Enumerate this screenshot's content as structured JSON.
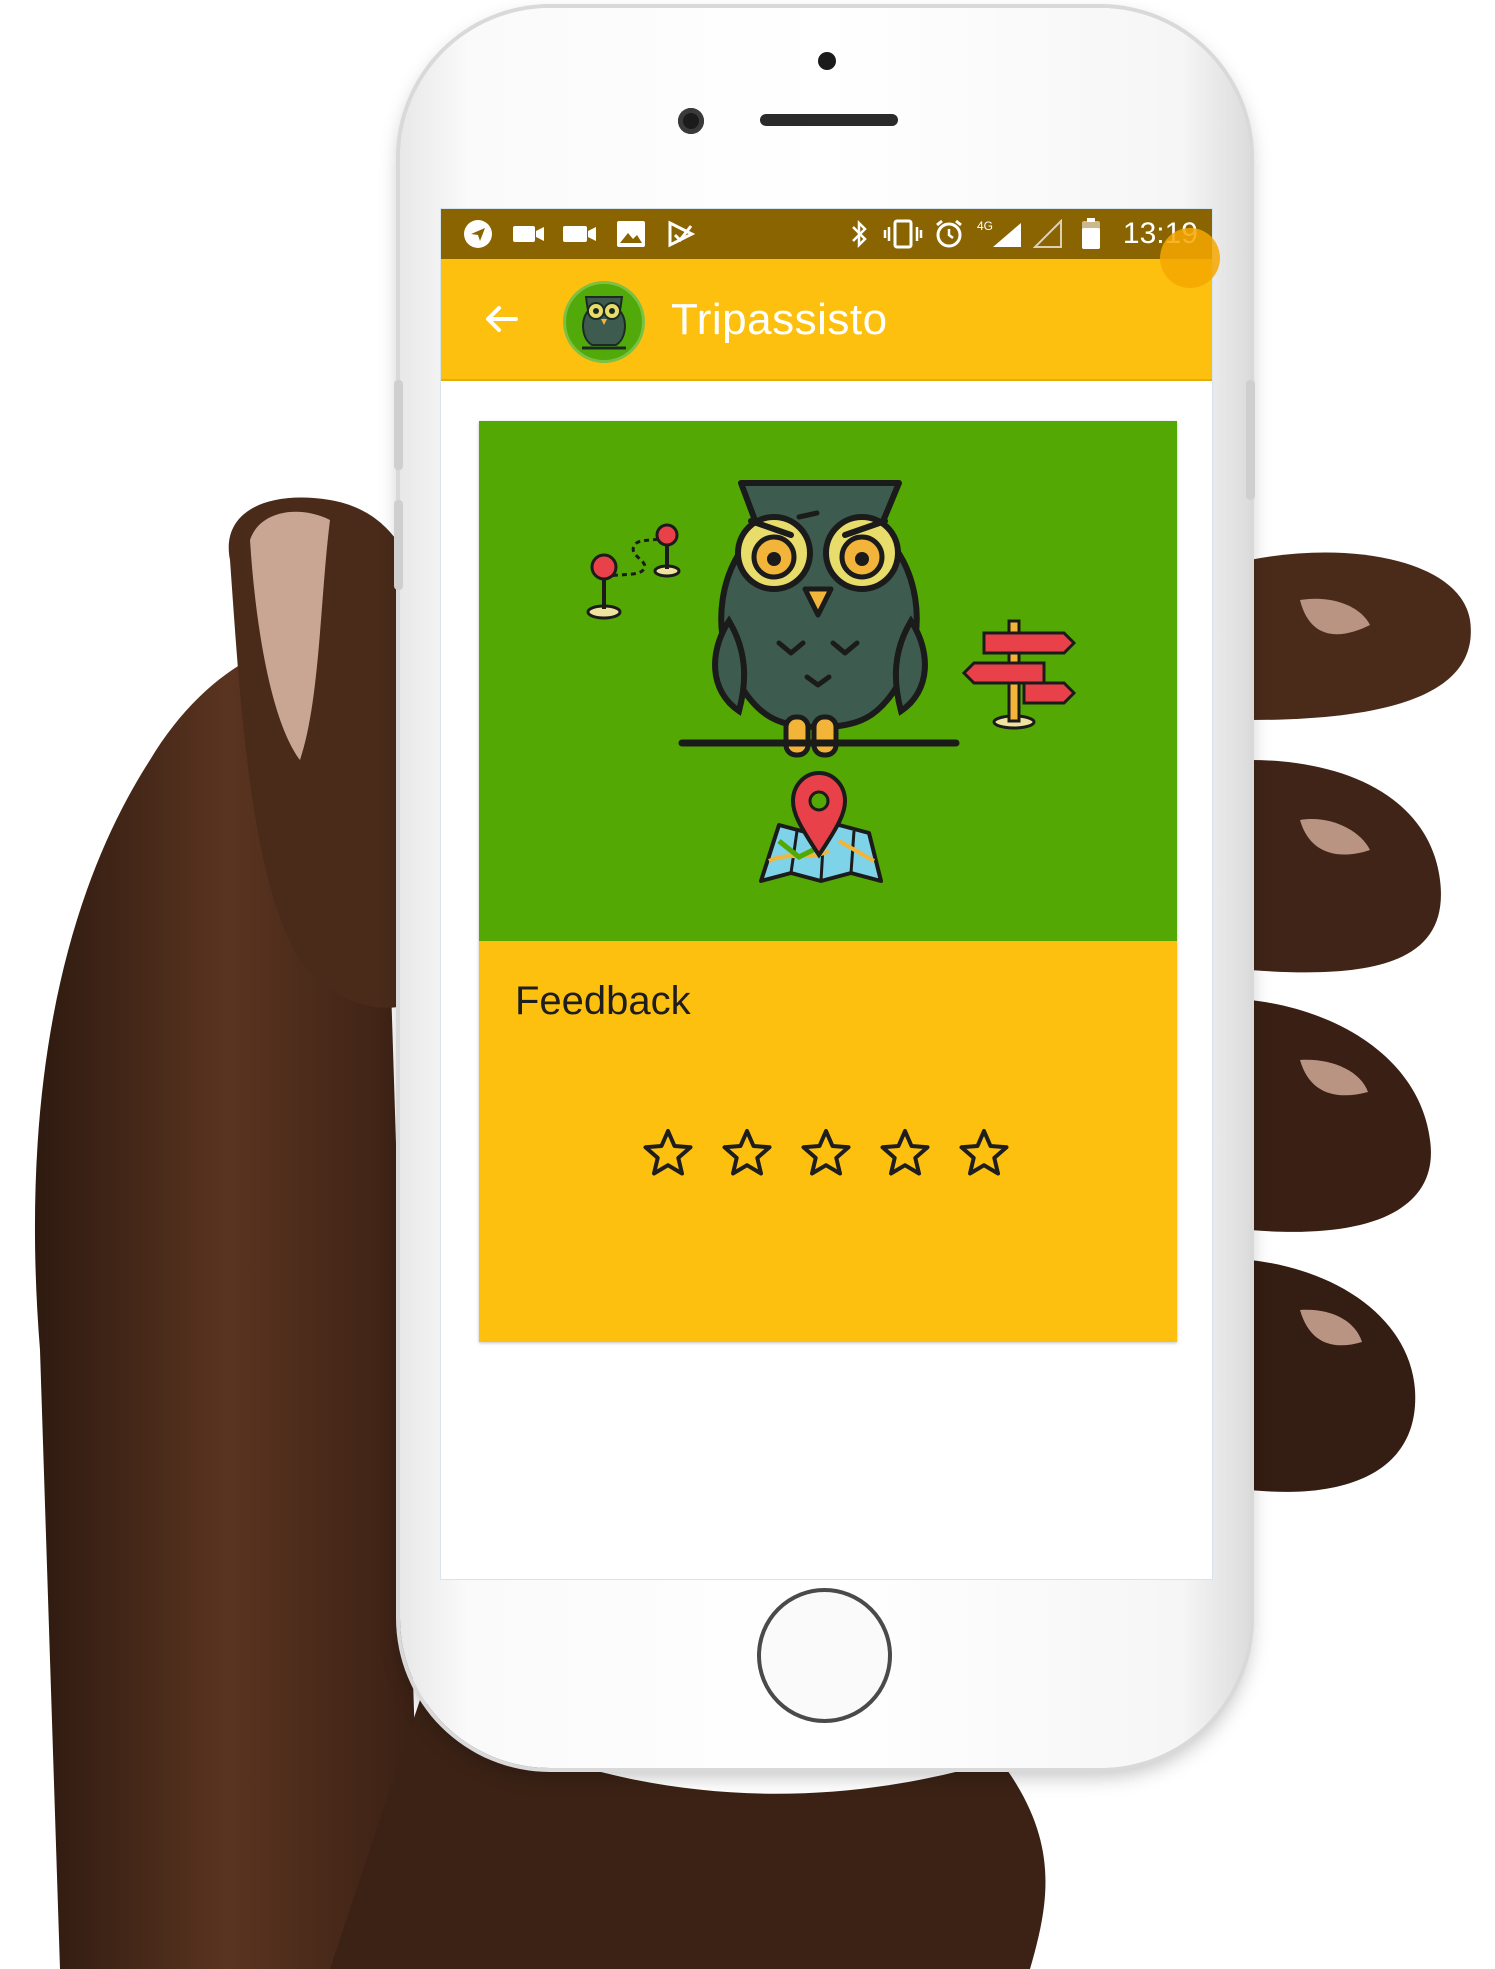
{
  "status_bar": {
    "time": "13:19",
    "network": "4G",
    "left_icons": [
      "telegram-icon",
      "video-camera-icon",
      "video-camera-icon",
      "image-icon",
      "play-store-icon"
    ],
    "right_icons": [
      "bluetooth-icon",
      "vibrate-icon",
      "alarm-icon",
      "signal-icon",
      "signal-empty-icon",
      "battery-icon"
    ]
  },
  "app_bar": {
    "title": "Tripassisto",
    "back_icon": "arrow-back-icon",
    "logo_icon": "owl-icon"
  },
  "card": {
    "title": "Feedback",
    "image_icons": [
      "route-pins-icon",
      "owl-icon",
      "signpost-icon",
      "map-pin-icon"
    ],
    "rating": {
      "value": 0,
      "max": 5
    }
  },
  "colors": {
    "status_bar": "#8a6400",
    "primary": "#fec00f",
    "image_background": "#53a803",
    "owl_body": "#3d5c4f",
    "text": "#1e1e1e"
  }
}
